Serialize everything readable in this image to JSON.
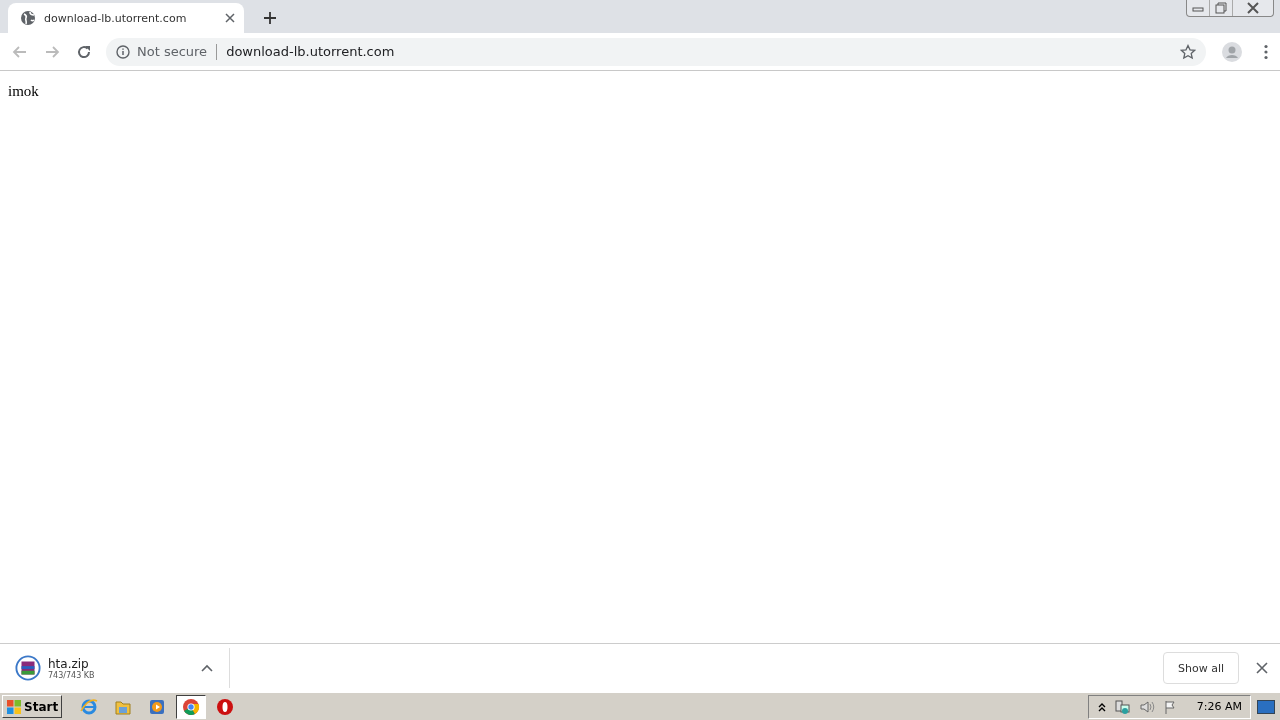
{
  "browser": {
    "tab": {
      "title": "download-lb.utorrent.com"
    },
    "address_bar": {
      "security": "Not secure",
      "url": "download-lb.utorrent.com"
    }
  },
  "page": {
    "text": "imok"
  },
  "download_bar": {
    "items": [
      {
        "filename": "hta.zip",
        "progress": "743/743 KB"
      }
    ],
    "show_all": "Show all"
  },
  "taskbar": {
    "start": "Start",
    "apps": [
      {
        "kind": "ie",
        "selected": false
      },
      {
        "kind": "folder",
        "selected": false
      },
      {
        "kind": "media",
        "selected": false
      },
      {
        "kind": "chrome",
        "selected": true
      },
      {
        "kind": "opera",
        "selected": false
      }
    ],
    "clock": "7:26 AM"
  }
}
